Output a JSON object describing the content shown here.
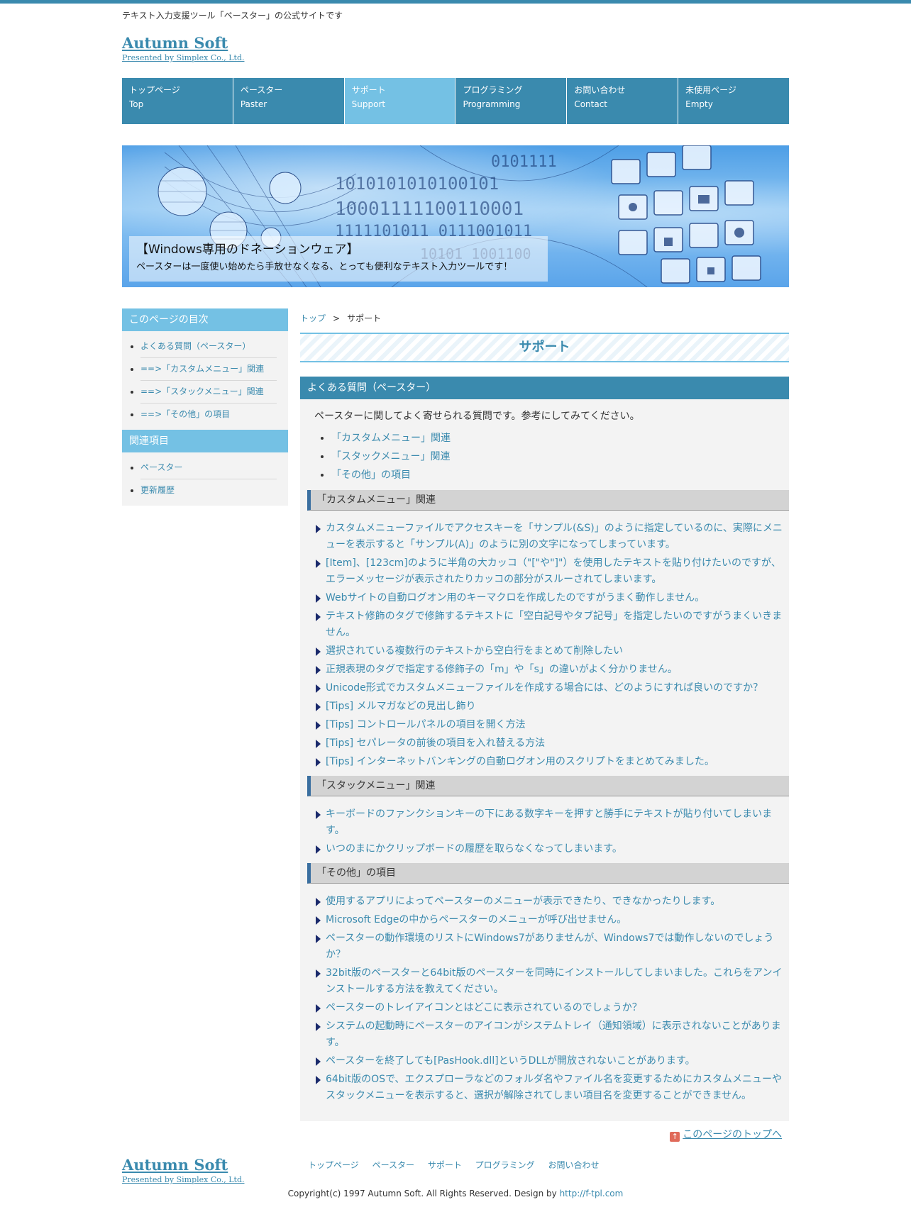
{
  "site": {
    "tagline": "テキスト入力支援ツール「ペースター」の公式サイトです",
    "logo": "Autumn Soft",
    "logo_sub": "Presented by Simplex Co., Ltd."
  },
  "nav": [
    {
      "jp": "トップページ",
      "en": "Top"
    },
    {
      "jp": "ペースター",
      "en": "Paster"
    },
    {
      "jp": "サポート",
      "en": "Support"
    },
    {
      "jp": "プログラミング",
      "en": "Programming"
    },
    {
      "jp": "お問い合わせ",
      "en": "Contact"
    },
    {
      "jp": "未使用ページ",
      "en": "Empty"
    }
  ],
  "hero": {
    "title": "【Windows専用のドネーションウェア】",
    "text": "ペースターは一度使い始めたら手放せなくなる、とっても便利なテキスト入力ツールです！"
  },
  "sidebar": {
    "toc_title": "このページの目次",
    "toc_items": [
      "よくある質問（ペースター）",
      "==>「カスタムメニュー」関連",
      "==>「スタックメニュー」関連",
      "==>「その他」の項目"
    ],
    "related_title": "関連項目",
    "related_items": [
      "ペースター",
      "更新履歴"
    ]
  },
  "breadcrumb": {
    "home": "トップ",
    "sep": ">",
    "current": "サポート"
  },
  "page_title": "サポート",
  "faq": {
    "title": "よくある質問（ペースター）",
    "intro": "ペースターに関してよく寄せられる質問です。参考にしてみてください。",
    "links": [
      "「カスタムメニュー」関連",
      "「スタックメニュー」関連",
      "「その他」の項目"
    ],
    "sections": [
      {
        "title": "「カスタムメニュー」関連",
        "items": [
          "カスタムメニューファイルでアクセスキーを「サンプル(&S)」のように指定しているのに、実際にメニューを表示すると「サンプル(A)」のように別の文字になってしまっています。",
          "[Item]、[123cm]のように半角の大カッコ（\"[\"や\"]\"）を使用したテキストを貼り付けたいのですが、エラーメッセージが表示されたりカッコの部分がスルーされてしまいます。",
          "Webサイトの自動ログオン用のキーマクロを作成したのですがうまく動作しません。",
          "テキスト修飾のタグで修飾するテキストに「空白記号やタブ記号」を指定したいのですがうまくいきません。",
          "選択されている複数行のテキストから空白行をまとめて削除したい",
          "正規表現のタグで指定する修飾子の「m」や「s」の違いがよく分かりません。",
          "Unicode形式でカスタムメニューファイルを作成する場合には、どのようにすれば良いのですか？",
          "[Tips] メルマガなどの見出し飾り",
          "[Tips] コントロールパネルの項目を開く方法",
          "[Tips] セパレータの前後の項目を入れ替える方法",
          "[Tips] インターネットバンキングの自動ログオン用のスクリプトをまとめてみました。"
        ]
      },
      {
        "title": "「スタックメニュー」関連",
        "items": [
          "キーボードのファンクションキーの下にある数字キーを押すと勝手にテキストが貼り付いてしまいます。",
          "いつのまにかクリップボードの履歴を取らなくなってしまいます。"
        ]
      },
      {
        "title": "「その他」の項目",
        "items": [
          "使用するアプリによってペースターのメニューが表示できたり、できなかったりします。",
          "Microsoft Edgeの中からペースターのメニューが呼び出せません。",
          "ペースターの動作環境のリストにWindows7がありませんが、Windows7では動作しないのでしょうか？",
          "32bit版のペースターと64bit版のペースターを同時にインストールしてしまいました。これらをアンインストールする方法を教えてください。",
          "ペースターのトレイアイコンとはどこに表示されているのでしょうか？",
          "システムの起動時にペースターのアイコンがシステムトレイ（通知領域）に表示されないことがあります。",
          "ペースターを終了しても[PasHook.dll]というDLLが開放されないことがあります。",
          "64bit版のOSで、エクスプローラなどのフォルダ名やファイル名を変更するためにカスタムメニューやスタックメニューを表示すると、選択が解除されてしまい項目名を変更することができません。"
        ]
      }
    ]
  },
  "pagetop": {
    "arrow": "↑",
    "label": "このページのトップへ"
  },
  "footer": {
    "logo": "Autumn Soft",
    "logo_sub": "Presented by Simplex Co., Ltd.",
    "nav": [
      "トップページ",
      "ペースター",
      "サポート",
      "プログラミング",
      "お問い合わせ"
    ],
    "copyright": "Copyright(c) 1997 Autumn Soft. All Rights Reserved. Design by ",
    "design_link": "http://f-tpl.com"
  },
  "colors": {
    "accent": "#3a8aae",
    "accent_light": "#74c1e4",
    "panel": "#f3f3f3"
  },
  "icons": {
    "pagetop": "arrow-up-icon",
    "bullet": "triangle-right-icon"
  }
}
